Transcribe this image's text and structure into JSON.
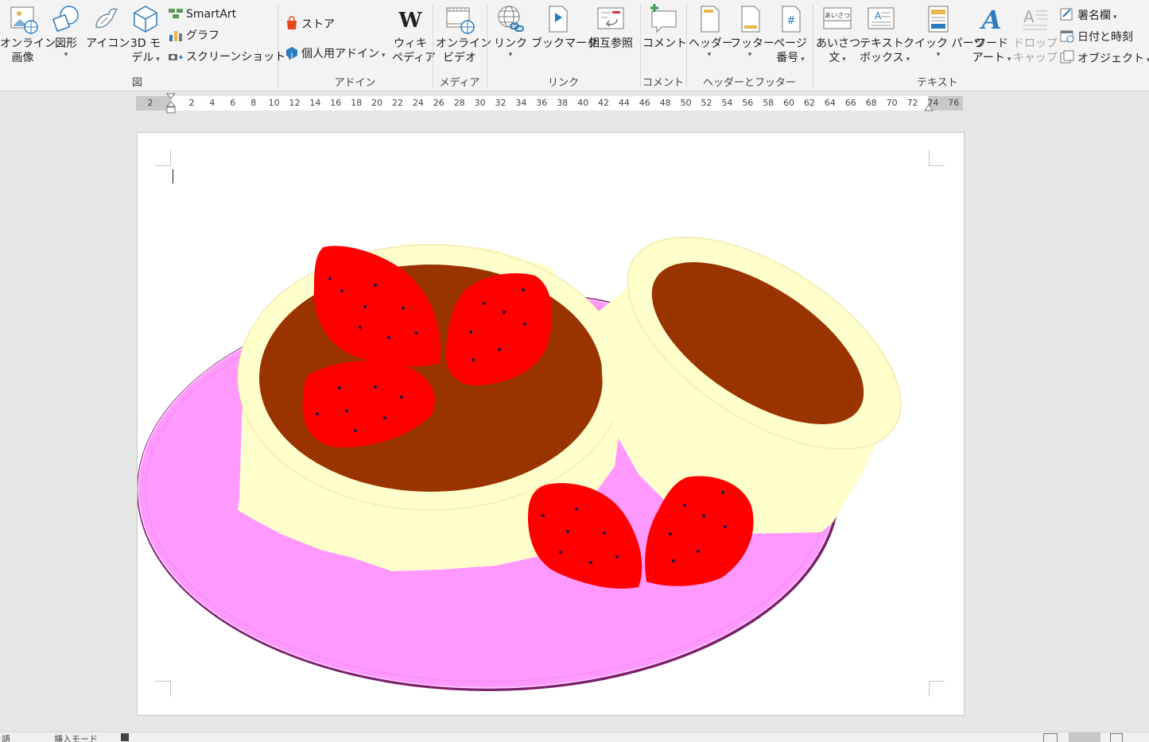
{
  "ribbon": {
    "groups": {
      "illustrations": "図",
      "addins": "アドイン",
      "media": "メディア",
      "links": "リンク",
      "comments": "コメント",
      "header_footer": "ヘッダーとフッター",
      "text": "テキスト"
    },
    "buttons": {
      "online_pictures": [
        "オンライン",
        "画像"
      ],
      "shapes": "図形",
      "icons": "アイコン",
      "models_3d": [
        "3D モ",
        "デル"
      ],
      "smartart": "SmartArt",
      "chart": "グラフ",
      "screenshot": "スクリーンショット",
      "store": "ストア",
      "my_addins": "個人用アドイン",
      "wikipedia": [
        "ウィキ",
        "ペディア"
      ],
      "online_video": [
        "オンライン",
        "ビデオ"
      ],
      "link": "リンク",
      "bookmark": "ブックマーク",
      "cross_reference": "相互参照",
      "comment": "コメント",
      "header": "ヘッダー",
      "footer": "フッター",
      "page_number": [
        "ページ",
        "番号"
      ],
      "greeting": [
        "あいさつ",
        "文"
      ],
      "text_box": [
        "テキスト",
        "ボックス"
      ],
      "quick_parts": "クイック パーツ",
      "wordart": [
        "ワード",
        "アート"
      ],
      "drop_cap": [
        "ドロップ",
        "キャップ"
      ],
      "signature_line": "署名欄",
      "date_time": "日付と時刻",
      "object": "オブジェクト",
      "greeting_icon_text": "あいさつ",
      "wikipedia_icon_text": "W"
    }
  },
  "ruler": {
    "ticks": [
      "2",
      "2",
      "4",
      "6",
      "8",
      "10",
      "12",
      "14",
      "16",
      "18",
      "20",
      "22",
      "24",
      "26",
      "28",
      "30",
      "32",
      "34",
      "36",
      "38",
      "40",
      "42",
      "44",
      "46",
      "48",
      "50",
      "52",
      "54",
      "56",
      "58",
      "60",
      "62",
      "64",
      "66",
      "68",
      "70",
      "72",
      "74",
      "76"
    ]
  },
  "statusbar": {
    "left": "語",
    "mode": "挿入モード"
  },
  "colors": {
    "plate": "#ff99ff",
    "plate_rim": "#7a1f6a",
    "cake": "#ffffcc",
    "chocolate": "#993300",
    "strawberry": "#ff0000",
    "seed": "#1a1a4a"
  }
}
